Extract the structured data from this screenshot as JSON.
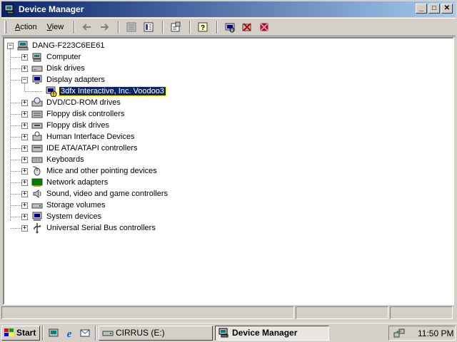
{
  "window": {
    "title": "Device Manager",
    "minimize_label": "_",
    "maximize_label": "□",
    "close_label": "✕"
  },
  "menu": {
    "action": {
      "ul": "A",
      "rest": "ction"
    },
    "view": {
      "ul": "V",
      "rest": "iew"
    }
  },
  "toolbar_icons": [
    "back-arrow-icon",
    "forward-arrow-icon",
    "show-list-icon",
    "show-details-icon",
    "properties-icon",
    "help-icon",
    "scan-hardware-icon",
    "uninstall-icon",
    "disable-icon"
  ],
  "tree": {
    "root": "DANG-F223C6EE61",
    "nodes": [
      {
        "label": "Computer",
        "expander": "+",
        "icon": "computer-icon"
      },
      {
        "label": "Disk drives",
        "expander": "+",
        "icon": "disk-drive-icon"
      },
      {
        "label": "Display adapters",
        "expander": "−",
        "icon": "display-adapter-icon"
      },
      {
        "label": "3dfx Interactive, Inc. Voodoo3",
        "child": true,
        "selected": true,
        "icon": "warning-device-icon"
      },
      {
        "label": "DVD/CD-ROM drives",
        "expander": "+",
        "icon": "cdrom-icon"
      },
      {
        "label": "Floppy disk controllers",
        "expander": "+",
        "icon": "floppy-controller-icon"
      },
      {
        "label": "Floppy disk drives",
        "expander": "+",
        "icon": "floppy-drive-icon"
      },
      {
        "label": "Human Interface Devices",
        "expander": "+",
        "icon": "hid-icon"
      },
      {
        "label": "IDE ATA/ATAPI controllers",
        "expander": "+",
        "icon": "ide-controller-icon"
      },
      {
        "label": "Keyboards",
        "expander": "+",
        "icon": "keyboard-icon"
      },
      {
        "label": "Mice and other pointing devices",
        "expander": "+",
        "icon": "mouse-icon"
      },
      {
        "label": "Network adapters",
        "expander": "+",
        "icon": "network-adapter-icon"
      },
      {
        "label": "Sound, video and game controllers",
        "expander": "+",
        "icon": "sound-icon"
      },
      {
        "label": "Storage volumes",
        "expander": "+",
        "icon": "storage-volume-icon"
      },
      {
        "label": "System devices",
        "expander": "+",
        "icon": "system-device-icon"
      },
      {
        "label": "Universal Serial Bus controllers",
        "expander": "+",
        "icon": "usb-icon"
      }
    ]
  },
  "taskbar": {
    "start_label": "Start",
    "tasks": [
      {
        "label": "CIRRUS (E:)",
        "icon": "drive-icon",
        "active": false
      },
      {
        "label": "Device Manager",
        "icon": "device-manager-icon",
        "active": true
      }
    ],
    "clock": "11:50 PM"
  },
  "colors": {
    "titlebar_start": "#0a246a",
    "titlebar_end": "#a6caf0",
    "selection": "#0a246a",
    "face": "#d4d0c8"
  }
}
